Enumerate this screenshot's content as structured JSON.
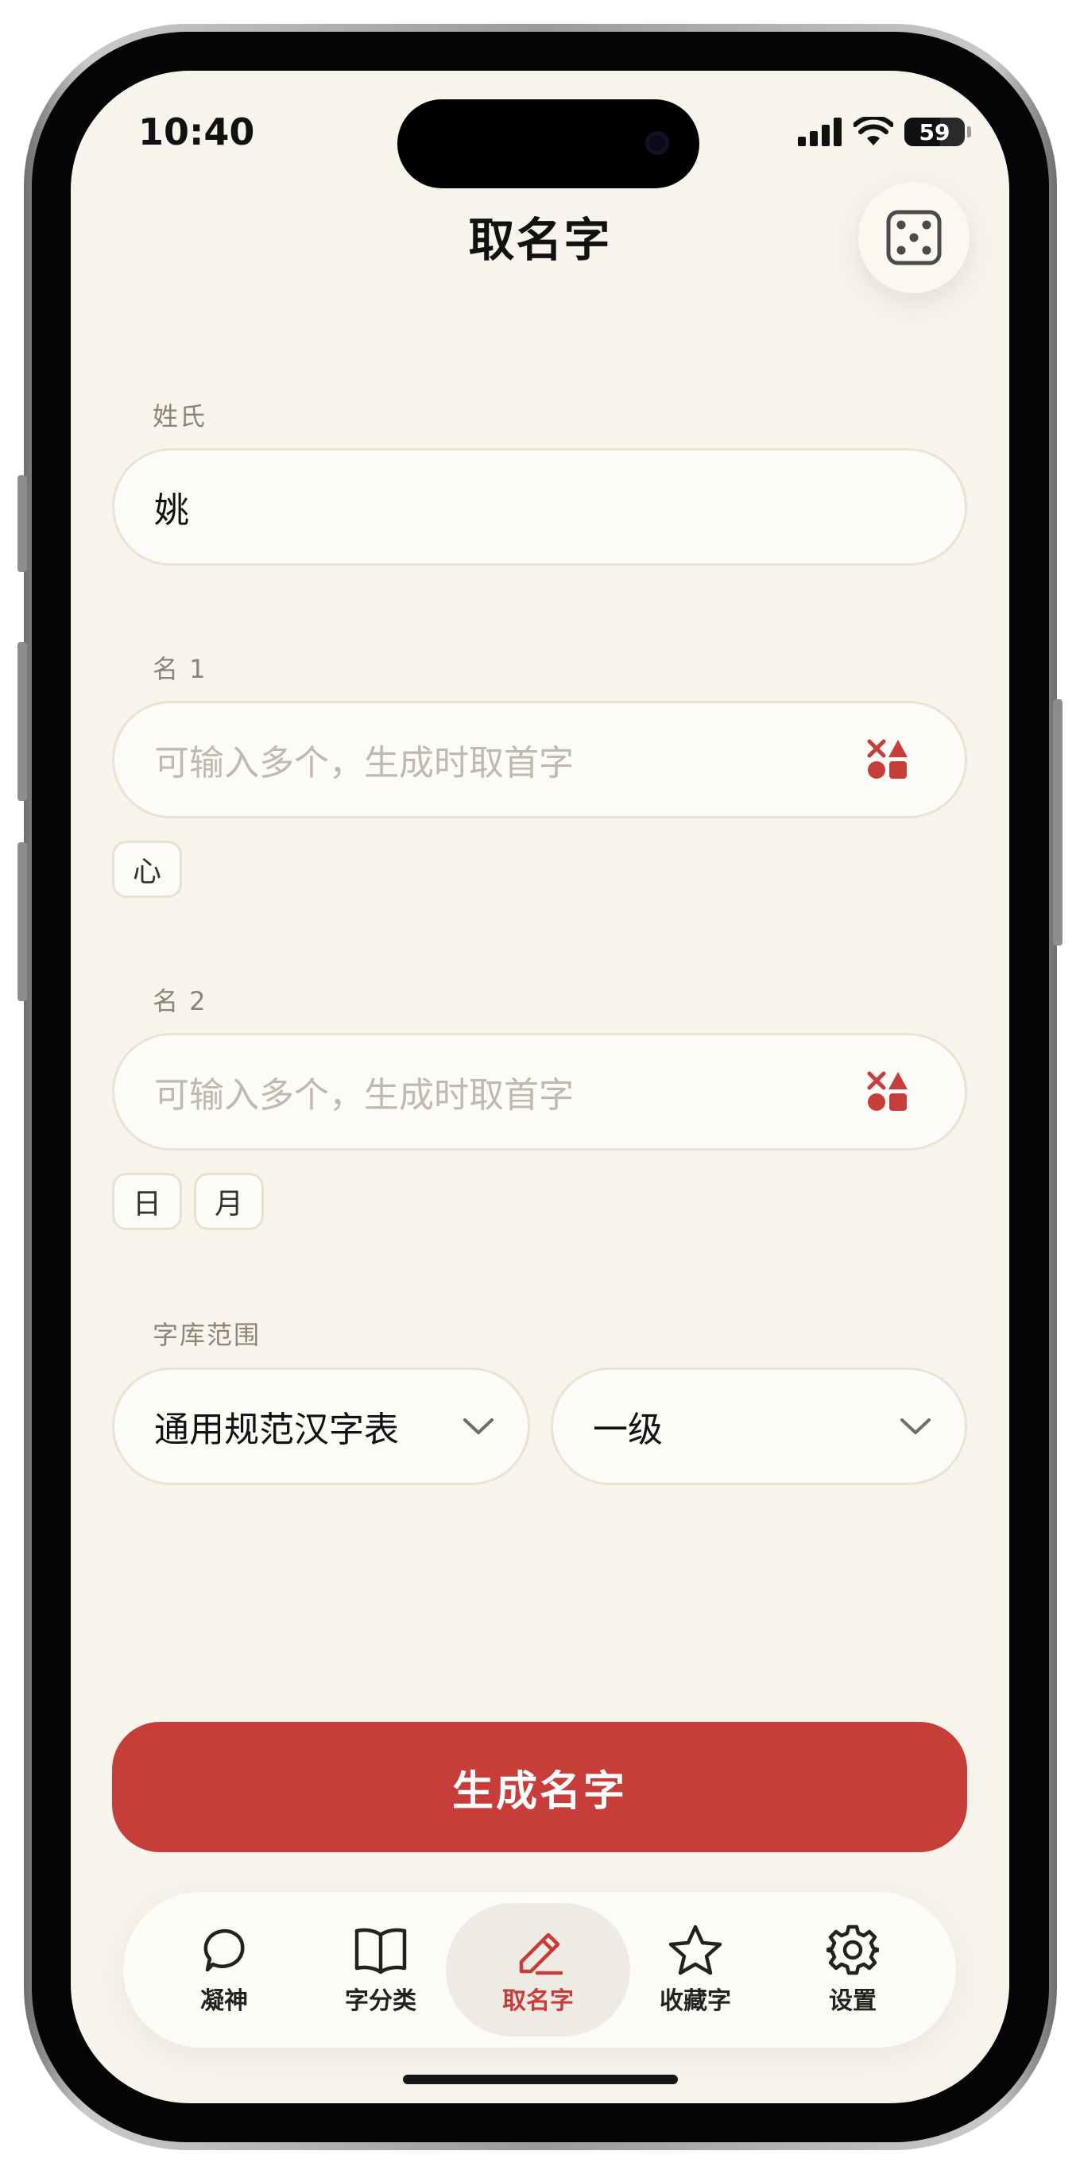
{
  "status": {
    "time": "10:40",
    "battery": "59",
    "battery_level": 0.59
  },
  "header": {
    "title": "取名字",
    "dice_icon": "dice-five-icon"
  },
  "surname": {
    "label": "姓氏",
    "value": "姚"
  },
  "name1": {
    "label": "名 1",
    "placeholder": "可输入多个，生成时取首字",
    "icon": "shapes-icon",
    "chips": [
      "心"
    ]
  },
  "name2": {
    "label": "名 2",
    "placeholder": "可输入多个，生成时取首字",
    "icon": "shapes-icon",
    "chips": [
      "日",
      "月"
    ]
  },
  "charset": {
    "label": "字库范围",
    "table": "通用规范汉字表",
    "level": "一级"
  },
  "generate": {
    "label": "生成名字"
  },
  "tabs": [
    {
      "label": "凝神",
      "icon": "speech-bubble-icon"
    },
    {
      "label": "字分类",
      "icon": "open-book-icon"
    },
    {
      "label": "取名字",
      "icon": "pencil-icon",
      "active": true
    },
    {
      "label": "收藏字",
      "icon": "star-icon"
    },
    {
      "label": "设置",
      "icon": "gear-icon"
    }
  ],
  "colors": {
    "accent": "#c73d3a",
    "background": "#f7f4ec",
    "field_border": "#ebe3cf",
    "label": "#8f8374"
  }
}
